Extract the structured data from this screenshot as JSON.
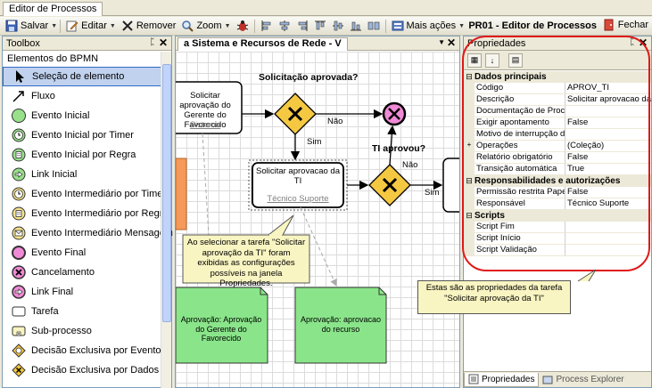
{
  "window_tab": "Editor de Processos",
  "toolbar": {
    "save": "Salvar",
    "edit": "Editar",
    "remove": "Remover",
    "zoom": "Zoom",
    "more": "Mais ações",
    "title": "PR01 - Editor de Processos",
    "close": "Fechar"
  },
  "toolbox": {
    "header": "Toolbox",
    "section": "Elementos do BPMN",
    "items": [
      {
        "label": "Seleção de elemento",
        "icon": "pointer-icon"
      },
      {
        "label": "Fluxo",
        "icon": "flow-arrow-icon"
      },
      {
        "label": "Evento Inicial",
        "icon": "start-event-icon"
      },
      {
        "label": "Evento Inicial por Timer",
        "icon": "timer-start-event-icon"
      },
      {
        "label": "Evento Inicial por Regra",
        "icon": "rule-start-event-icon"
      },
      {
        "label": "Link Inicial",
        "icon": "link-start-icon"
      },
      {
        "label": "Evento Intermediário por Timer",
        "icon": "timer-intermediate-event-icon"
      },
      {
        "label": "Evento Intermediário por Regra",
        "icon": "rule-intermediate-event-icon"
      },
      {
        "label": "Evento Intermediário Mensagem",
        "icon": "message-intermediate-event-icon"
      },
      {
        "label": "Evento Final",
        "icon": "end-event-icon"
      },
      {
        "label": "Cancelamento",
        "icon": "cancel-event-icon"
      },
      {
        "label": "Link Final",
        "icon": "link-end-icon"
      },
      {
        "label": "Tarefa",
        "icon": "task-icon"
      },
      {
        "label": "Sub-processo",
        "icon": "subprocess-icon"
      },
      {
        "label": "Decisão Exclusiva por Evento",
        "icon": "event-gateway-icon"
      },
      {
        "label": "Decisão Exclusiva por Dados",
        "icon": "data-gateway-icon"
      }
    ]
  },
  "editor": {
    "tab": "a Sistema e Recursos de Rede - V",
    "task1": {
      "title": "Solicitar aprovação do Gerente do Favorecido",
      "role": "Sistema"
    },
    "task2": {
      "title": "Solicitar aprovacao da TI",
      "role": "Técnico Suporte"
    },
    "gateway1_label": "Solicitação aprovada?",
    "gateway2_label": "TI aprovou?",
    "yes": "Sim",
    "no": "Não",
    "callout": "Ao selecionar a tarefa \"Solicitar aprovação da TI\" foram exibidas as configurações possíveis na janela Propriedades.",
    "note1": "Aprovação: Aprovação do Gerente do Favorecido",
    "note2": "Aprovação: aprovacao do recurso"
  },
  "properties": {
    "header": "Propriedades",
    "categories": [
      {
        "name": "Dados principais",
        "rows": [
          {
            "name": "Código",
            "value": "APROV_TI"
          },
          {
            "name": "Descrição",
            "value": "Solicitar aprovacao da TI"
          },
          {
            "name": "Documentação de Processo",
            "value": ""
          },
          {
            "name": "Exigir apontamento",
            "value": "False"
          },
          {
            "name": "Motivo de interrupção de",
            "value": ""
          },
          {
            "name": "Operações",
            "value": "(Coleção)",
            "expand": "+"
          },
          {
            "name": "Relatório obrigatório",
            "value": "False"
          },
          {
            "name": "Transição automática",
            "value": "True"
          }
        ]
      },
      {
        "name": "Responsabilidades e autorizações",
        "rows": [
          {
            "name": "Permissão restrita Papel r",
            "value": "False"
          },
          {
            "name": "Responsável",
            "value": "Técnico Suporte"
          }
        ]
      },
      {
        "name": "Scripts",
        "rows": [
          {
            "name": "Script Fim",
            "value": ""
          },
          {
            "name": "Script Início",
            "value": ""
          },
          {
            "name": "Script Validação",
            "value": ""
          }
        ]
      }
    ],
    "callout": "Estas são as propriedades da tarefa \"Solicitar aprovação da TI\"",
    "tab_props": "Propriedades",
    "tab_explorer": "Process Explorer"
  }
}
